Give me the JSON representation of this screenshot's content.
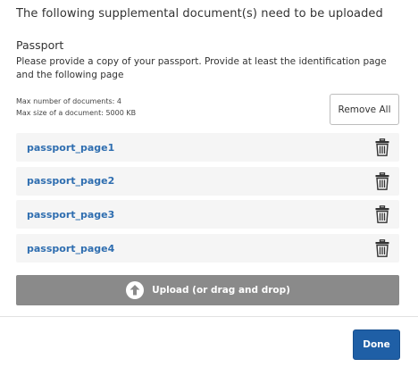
{
  "dialog": {
    "heading": "The following supplemental document(s) need to be uploaded"
  },
  "section": {
    "title": "Passport",
    "description": "Please provide a copy of your passport. Provide at least the identification page and the following page",
    "max_documents": "Max number of documents: 4",
    "max_size": "Max size of a document: 5000 KB",
    "remove_all_label": "Remove All"
  },
  "documents": [
    {
      "name": "passport_page1",
      "delete_icon": "trash-icon"
    },
    {
      "name": "passport_page2",
      "delete_icon": "trash-icon"
    },
    {
      "name": "passport_page3",
      "delete_icon": "trash-icon"
    },
    {
      "name": "passport_page4",
      "delete_icon": "trash-icon"
    }
  ],
  "upload": {
    "label": "Upload (or drag and drop)",
    "icon": "upload-arrow-icon"
  },
  "footer": {
    "done_label": "Done"
  },
  "colors": {
    "link": "#2f6eb0",
    "upload_button": "#8a8a8a",
    "primary_button": "#1f5fa6",
    "row_background": "#f5f5f5"
  }
}
